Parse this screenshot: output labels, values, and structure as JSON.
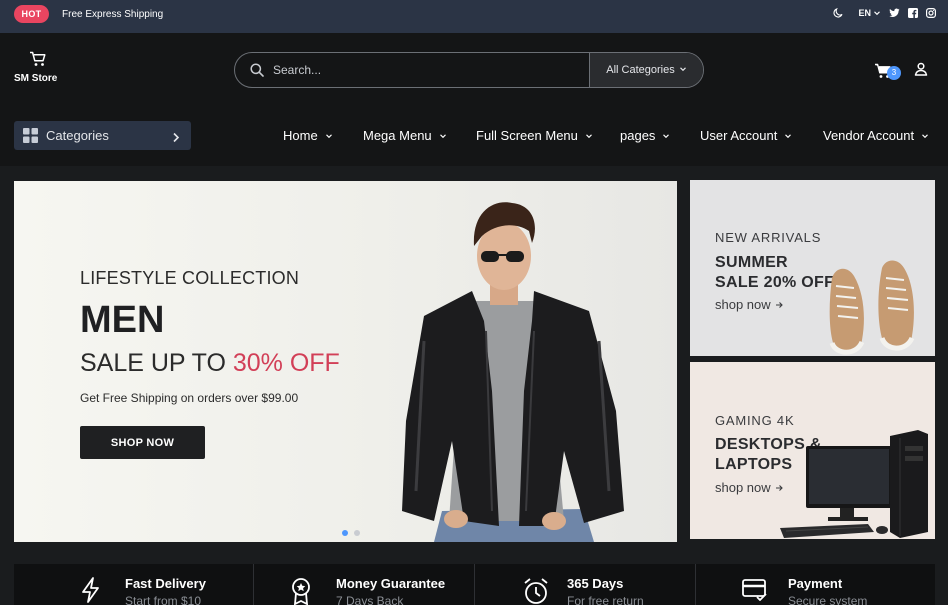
{
  "topbar": {
    "badge": "HOT",
    "text": "Free Express Shipping",
    "language": "EN",
    "icons": [
      "moon-icon",
      "chevron-down-icon",
      "twitter-icon",
      "facebook-icon",
      "instagram-icon"
    ]
  },
  "header": {
    "logo_text": "SM Store",
    "search": {
      "placeholder": "Search...",
      "category": "All Categories"
    },
    "cart_count": "3",
    "icons": [
      "cart-icon",
      "user-icon",
      "search-icon"
    ]
  },
  "nav": {
    "categories_label": "Categories",
    "items": [
      {
        "label": "Home"
      },
      {
        "label": "Mega Menu"
      },
      {
        "label": "Full Screen Menu"
      },
      {
        "label": "pages"
      },
      {
        "label": "User Account"
      },
      {
        "label": "Vendor Account"
      }
    ]
  },
  "hero": {
    "subtitle": "LIFESTYLE COLLECTION",
    "title": "MEN",
    "sale_prefix": "SALE UP TO ",
    "sale_accent": "30% OFF",
    "shipping": "Get Free Shipping on orders over $99.00",
    "button": "SHOP NOW",
    "slides": 2,
    "active_slide": 1
  },
  "side_banners": [
    {
      "tag": "NEW ARRIVALS",
      "title_line1": "SUMMER",
      "title_line2": "SALE 20% OFF",
      "link": "shop now"
    },
    {
      "tag": "GAMING 4K",
      "title_line1": "DESKTOPS &",
      "title_line2": "LAPTOPS",
      "link": "shop now"
    }
  ],
  "services": [
    {
      "title": "Fast Delivery",
      "subtitle": "Start from $10",
      "icon": "lightning-icon"
    },
    {
      "title": "Money Guarantee",
      "subtitle": "7 Days Back",
      "icon": "award-icon"
    },
    {
      "title": "365 Days",
      "subtitle": "For free return",
      "icon": "alarm-clock-icon"
    },
    {
      "title": "Payment",
      "subtitle": "Secure system",
      "icon": "credit-card-icon"
    }
  ],
  "colors": {
    "accent": "#d23f57",
    "hot_badge": "#e94560",
    "topbar": "#2b3445",
    "cart_badge": "#4e97fd"
  }
}
